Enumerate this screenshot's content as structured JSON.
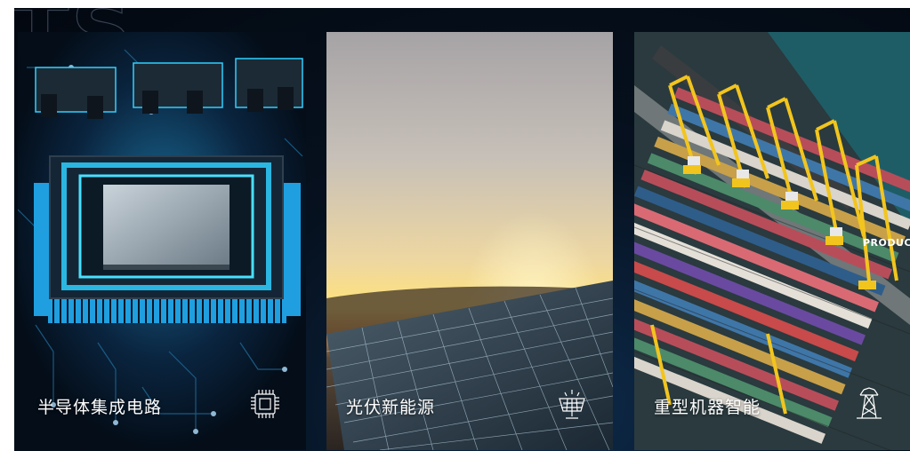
{
  "background_text": "TS",
  "cards": [
    {
      "label": "半导体集成电路",
      "icon": "chip-icon"
    },
    {
      "label": "光伏新能源",
      "icon": "solar-panel-icon"
    },
    {
      "label": "重型机器智能",
      "icon": "power-tower-icon"
    }
  ],
  "side_text": "PRODUC",
  "colors": {
    "accent": "#2fd0ff",
    "background": "#06111f"
  }
}
